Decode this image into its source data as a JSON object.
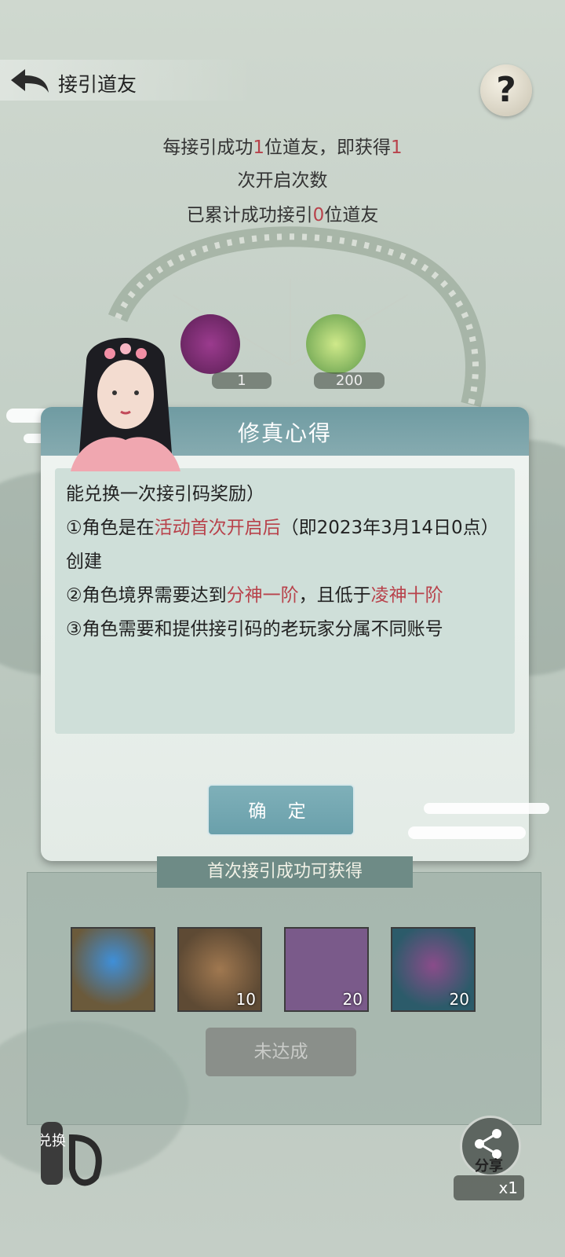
{
  "header": {
    "title": "接引道友",
    "help_label": "?"
  },
  "info": {
    "line1_a": "每接引成功",
    "line1_n": "1",
    "line1_b": "位道友，即获得",
    "line1_m": "1",
    "line2": "次开启次数",
    "line3_a": "已累计成功接引",
    "line3_n": "0",
    "line3_b": "位道友"
  },
  "wheel_rewards": [
    {
      "icon": "purple-pouch-icon",
      "count": "1"
    },
    {
      "icon": "jade-pendant-icon",
      "count": "200"
    }
  ],
  "modal": {
    "title": "修真心得",
    "intro": "能兑换一次接引码奖励）",
    "rule1_a": "①角色是在",
    "rule1_hl": "活动首次开启后",
    "rule1_b": "（即2023年3月14日0点）创建",
    "rule2_a": "②角色境界需要达到",
    "rule2_hl1": "分神一阶",
    "rule2_b": "，且低于",
    "rule2_hl2": "凌神十阶",
    "rule3": "③角色需要和提供接引码的老玩家分属不同账号",
    "confirm_label": "确 定"
  },
  "reward_panel": {
    "title": "首次接引成功可获得",
    "items": [
      {
        "icon": "blue-orb-icon",
        "count": ""
      },
      {
        "icon": "treasure-chest-icon",
        "count": "10"
      },
      {
        "icon": "seeds-icon",
        "count": "20"
      },
      {
        "icon": "purple-orb-icon",
        "count": "20"
      }
    ],
    "status_label": "未达成"
  },
  "footer": {
    "exchange_label": "兑换",
    "share_label": "分享",
    "share_count": "x1"
  },
  "colors": {
    "highlight": "#b8424b",
    "modal_header": "#7aa3aa",
    "confirm_button": "#74a8b2"
  }
}
